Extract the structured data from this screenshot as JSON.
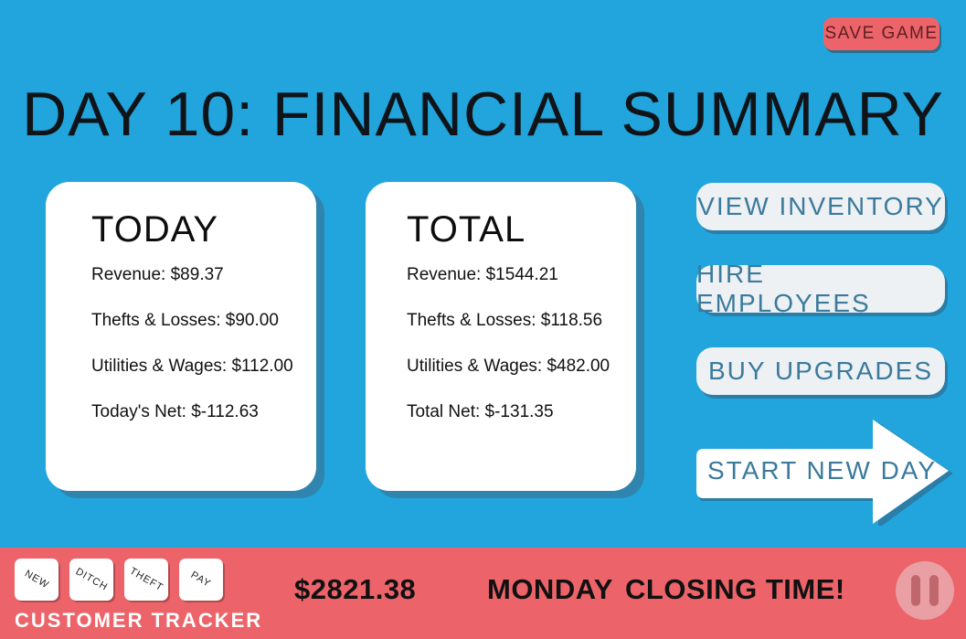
{
  "header": {
    "save_label": "SAVE GAME",
    "title": "DAY 10: FINANCIAL SUMMARY"
  },
  "today": {
    "heading": "TODAY",
    "revenue": "Revenue: $89.37",
    "thefts": "Thefts & Losses: $90.00",
    "utilities": "Utilities & Wages: $112.00",
    "net": "Today's Net: $-112.63"
  },
  "total": {
    "heading": "TOTAL",
    "revenue": "Revenue: $1544.21",
    "thefts": "Thefts & Losses: $118.56",
    "utilities": "Utilities & Wages: $482.00",
    "net": "Total Net: $-131.35"
  },
  "actions": {
    "inventory": "VIEW INVENTORY",
    "hire": "HIRE EMPLOYEES",
    "upgrades": "BUY UPGRADES",
    "start": "START NEW DAY"
  },
  "bottom": {
    "tracker_buttons": [
      "NEW",
      "DITCH",
      "THEFT",
      "PAY"
    ],
    "tracker_label": "CUSTOMER TRACKER",
    "money": "$2821.38",
    "weekday": "MONDAY",
    "status": "CLOSING TIME!",
    "pause_icon": "pause-icon"
  },
  "colors": {
    "background": "#21a5dc",
    "accent_red": "#ec6469",
    "button_text": "#3a7a9c",
    "card": "#ffffff"
  }
}
